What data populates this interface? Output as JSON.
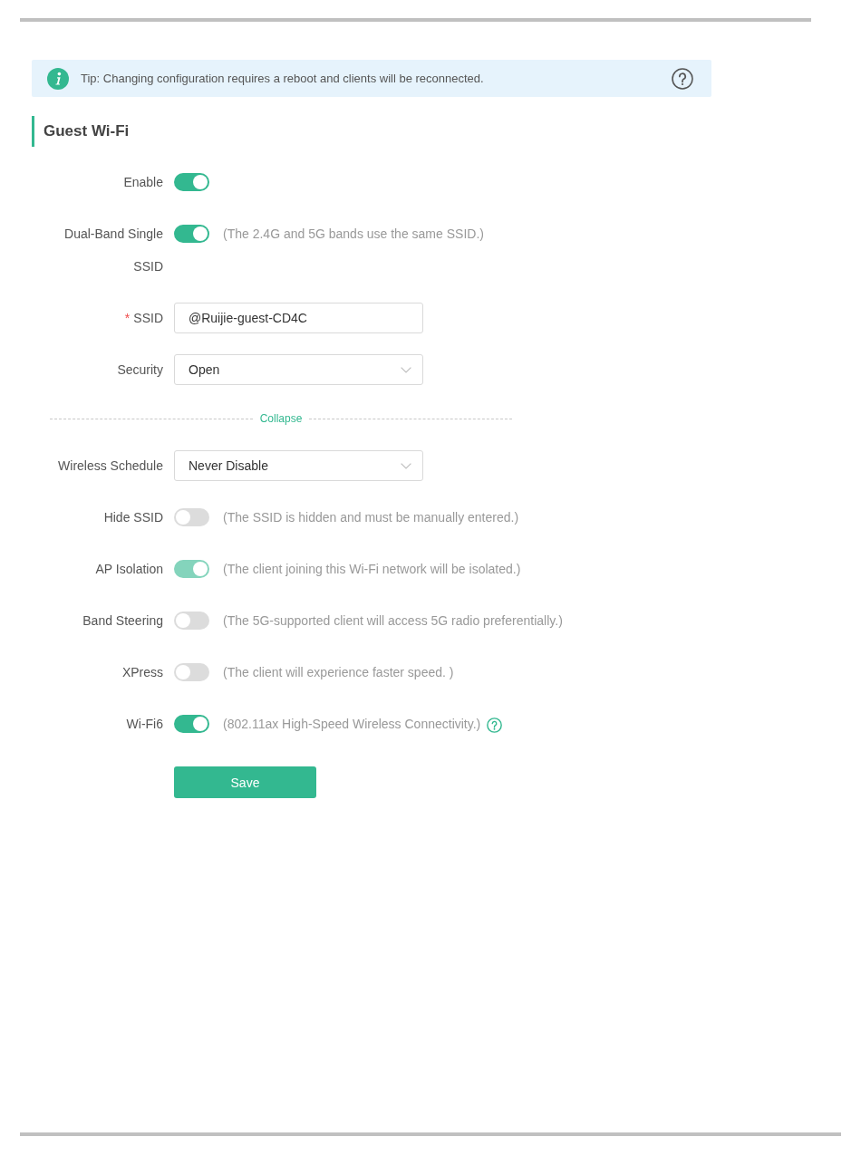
{
  "tip": {
    "text": "Tip: Changing configuration requires a reboot and clients will be reconnected."
  },
  "section": {
    "title": "Guest Wi-Fi"
  },
  "basic_settings": [
    {
      "kind": "toggle",
      "label": "Enable",
      "on": true,
      "disabled": false
    },
    {
      "kind": "toggle",
      "label": "Dual-Band Single SSID",
      "on": true,
      "disabled": false,
      "note": "(The 2.4G and 5G bands use the same SSID.)"
    },
    {
      "kind": "input",
      "label": "SSID",
      "required_mark": "*",
      "value": "@Ruijie-guest-CD4C"
    },
    {
      "kind": "select",
      "label": "Security",
      "value": "Open"
    }
  ],
  "collapse_link": {
    "label": "Collapse"
  },
  "advanced_settings": [
    {
      "kind": "select",
      "label": "Wireless Schedule",
      "value": "Never Disable"
    },
    {
      "kind": "toggle",
      "label": "Hide SSID",
      "on": false,
      "disabled": false,
      "note": "(The SSID is hidden and must be manually entered.)"
    },
    {
      "kind": "toggle",
      "label": "AP Isolation",
      "on": true,
      "disabled": true,
      "note": "(The client joining this Wi-Fi network will be isolated.)"
    },
    {
      "kind": "toggle",
      "label": "Band Steering",
      "on": false,
      "disabled": false,
      "note": "(The 5G-supported client will access 5G radio preferentially.)"
    },
    {
      "kind": "toggle",
      "label": "XPress",
      "on": false,
      "disabled": false,
      "note": "(The client will experience faster speed. )"
    },
    {
      "kind": "toggle",
      "label": "Wi-Fi6",
      "on": true,
      "disabled": false,
      "note": "(802.11ax High-Speed Wireless Connectivity.)",
      "help": true
    }
  ],
  "save_button": {
    "label": "Save"
  }
}
